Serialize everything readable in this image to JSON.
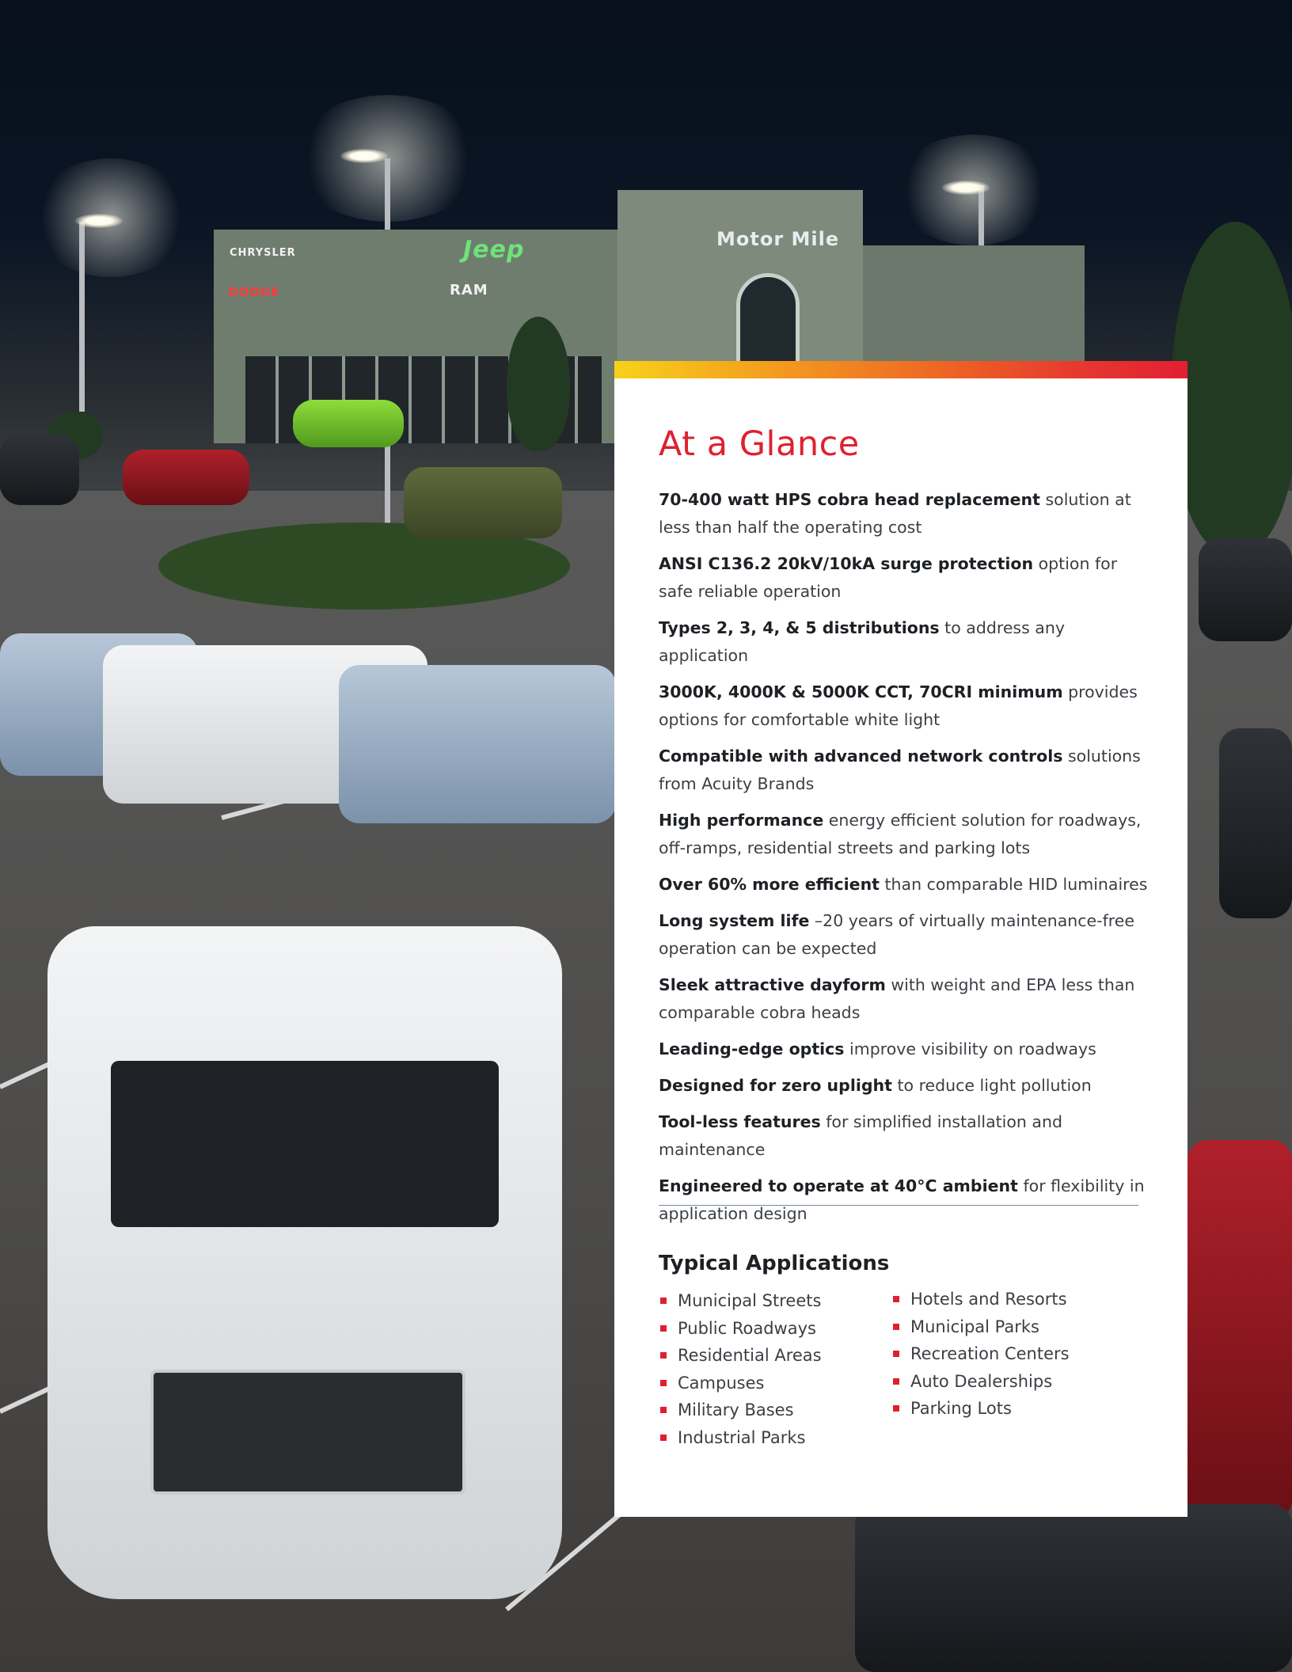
{
  "photo": {
    "signs": {
      "chrysler": "CHRYSLER",
      "dodge": "DODGE",
      "jeep": "Jeep",
      "ram": "RAM",
      "motor_mile": "Motor Mile"
    }
  },
  "panel": {
    "title": "At a Glance",
    "features": [
      {
        "bold": "70-400 watt HPS cobra head replacement",
        "text": " solution at less than half the operating cost"
      },
      {
        "bold": "ANSI C136.2 20kV/10kA surge protection",
        "text": " option for safe reliable operation"
      },
      {
        "bold": "Types 2, 3, 4, & 5 distributions",
        "text": " to address any application"
      },
      {
        "bold": "3000K, 4000K & 5000K CCT, 70CRI minimum",
        "text": " provides options for comfortable white light"
      },
      {
        "bold": "Compatible with advanced network controls",
        "text": " solutions from Acuity Brands"
      },
      {
        "bold": "High performance",
        "text": " energy efficient solution for roadways, off-ramps, residential streets and parking lots"
      },
      {
        "bold": "Over 60% more efficient",
        "text": " than comparable HID luminaires"
      },
      {
        "bold": "Long system life",
        "text": " –20 years of virtually maintenance-free operation can be expected"
      },
      {
        "bold": "Sleek attractive dayform",
        "text": " with weight and EPA less than comparable cobra heads"
      },
      {
        "bold": "Leading-edge optics",
        "text": " improve visibility on roadways"
      },
      {
        "bold": "Designed for zero uplight",
        "text": " to reduce light pollution"
      },
      {
        "bold": "Tool-less features",
        "text": " for simplified installation and maintenance"
      },
      {
        "bold": "Engineered to operate at 40°C ambient",
        "text": " for flexibility in application design"
      }
    ],
    "applications_title": "Typical Applications",
    "applications_left": [
      "Municipal Streets",
      "Public Roadways",
      "Residential Areas",
      "Campuses",
      "Military Bases",
      "Industrial Parks"
    ],
    "applications_right": [
      "Hotels and Resorts",
      "Municipal Parks",
      "Recreation Centers",
      "Auto Dealerships",
      "Parking Lots"
    ],
    "colors": {
      "title_red": "#e0202f",
      "bullet_red": "#e0202f",
      "gradient": [
        "#f7d11a",
        "#f4a11e",
        "#ee6a24",
        "#e63a2e",
        "#e21f33"
      ]
    }
  }
}
